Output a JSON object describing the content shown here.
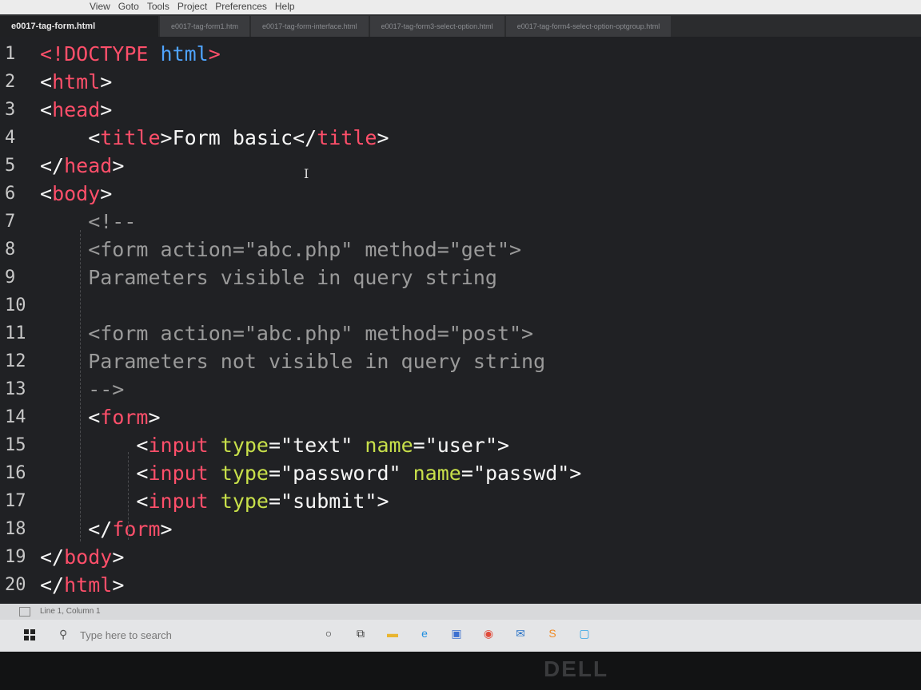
{
  "menu": {
    "items": [
      "View",
      "Goto",
      "Tools",
      "Project",
      "Preferences",
      "Help"
    ]
  },
  "tabs": [
    {
      "label": "e0017-tag-form.html",
      "active": true
    },
    {
      "label": "e0017-tag-form1.htm",
      "active": false
    },
    {
      "label": "e0017-tag-form-interface.html",
      "active": false
    },
    {
      "label": "e0017-tag-form3-select-option.html",
      "active": false
    },
    {
      "label": "e0017-tag-form4-select-option-optgroup.html",
      "active": false
    }
  ],
  "editor": {
    "line_numbers": [
      "1",
      "2",
      "3",
      "4",
      "5",
      "6",
      "7",
      "8",
      "9",
      "10",
      "11",
      "12",
      "13",
      "14",
      "15",
      "16",
      "17",
      "18",
      "19",
      "20"
    ],
    "lines": [
      [
        [
          "t",
          "<!DOCTYPE "
        ],
        [
          "k",
          "html"
        ],
        [
          "t",
          ">"
        ]
      ],
      [
        [
          "s",
          "<"
        ],
        [
          "t",
          "html"
        ],
        [
          "s",
          ">"
        ]
      ],
      [
        [
          "s",
          "<"
        ],
        [
          "t",
          "head"
        ],
        [
          "s",
          ">"
        ]
      ],
      [
        [
          "s",
          "    <"
        ],
        [
          "t",
          "title"
        ],
        [
          "s",
          ">Form basic</"
        ],
        [
          "t",
          "title"
        ],
        [
          "s",
          ">"
        ]
      ],
      [
        [
          "s",
          "</"
        ],
        [
          "t",
          "head"
        ],
        [
          "s",
          ">"
        ]
      ],
      [
        [
          "s",
          "<"
        ],
        [
          "t",
          "body"
        ],
        [
          "s",
          ">"
        ]
      ],
      [
        [
          "c",
          "    <!--"
        ]
      ],
      [
        [
          "c",
          "    <form action=\"abc.php\" method=\"get\">"
        ]
      ],
      [
        [
          "c",
          "    Parameters visible in query string"
        ]
      ],
      [
        [
          "c",
          ""
        ]
      ],
      [
        [
          "c",
          "    <form action=\"abc.php\" method=\"post\">"
        ]
      ],
      [
        [
          "c",
          "    Parameters not visible in query string"
        ]
      ],
      [
        [
          "c",
          "    -->"
        ]
      ],
      [
        [
          "s",
          "    <"
        ],
        [
          "t",
          "form"
        ],
        [
          "s",
          ">"
        ]
      ],
      [
        [
          "s",
          "        <"
        ],
        [
          "t",
          "input "
        ],
        [
          "a",
          "type"
        ],
        [
          "s",
          "=\"text\" "
        ],
        [
          "a",
          "name"
        ],
        [
          "s",
          "=\"user\">"
        ]
      ],
      [
        [
          "s",
          "        <"
        ],
        [
          "t",
          "input "
        ],
        [
          "a",
          "type"
        ],
        [
          "s",
          "=\"password\" "
        ],
        [
          "a",
          "name"
        ],
        [
          "s",
          "=\"passwd\">"
        ]
      ],
      [
        [
          "s",
          "        <"
        ],
        [
          "t",
          "input "
        ],
        [
          "a",
          "type"
        ],
        [
          "s",
          "=\"submit\">"
        ]
      ],
      [
        [
          "s",
          "    </"
        ],
        [
          "t",
          "form"
        ],
        [
          "s",
          ">"
        ]
      ],
      [
        [
          "s",
          "</"
        ],
        [
          "t",
          "body"
        ],
        [
          "s",
          ">"
        ]
      ],
      [
        [
          "s",
          "</"
        ],
        [
          "t",
          "html"
        ],
        [
          "s",
          ">"
        ]
      ]
    ],
    "caret_glyph": "I"
  },
  "status": {
    "text": "Line 1, Column 1"
  },
  "taskbar": {
    "search_placeholder": "Type here to search",
    "icons": [
      {
        "name": "cortana-icon",
        "glyph": "○",
        "color": "#333"
      },
      {
        "name": "task-view-icon",
        "glyph": "⧉",
        "color": "#333"
      },
      {
        "name": "file-explorer-icon",
        "glyph": "▬",
        "color": "#e9b530"
      },
      {
        "name": "edge-icon",
        "glyph": "e",
        "color": "#1f8ee0"
      },
      {
        "name": "store-icon",
        "glyph": "▣",
        "color": "#3b6fd0"
      },
      {
        "name": "chrome-icon",
        "glyph": "◉",
        "color": "#e04a3a"
      },
      {
        "name": "mail-icon",
        "glyph": "✉",
        "color": "#2a73c7"
      },
      {
        "name": "sublime-icon",
        "glyph": "S",
        "color": "#f08a24"
      },
      {
        "name": "app-icon",
        "glyph": "▢",
        "color": "#2ea3e6"
      }
    ]
  },
  "brand": "DELL"
}
